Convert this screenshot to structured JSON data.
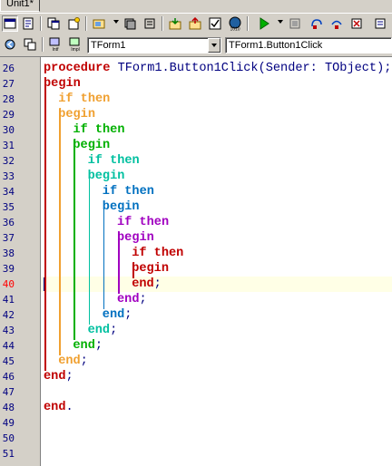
{
  "tab": {
    "label": "Unit1*"
  },
  "combos": {
    "class_name": "TForm1",
    "method_name": "TForm1.Button1Click"
  },
  "gutter": {
    "line_numbers": [
      "26",
      "27",
      "28",
      "29",
      "30",
      "31",
      "32",
      "33",
      "34",
      "35",
      "36",
      "37",
      "38",
      "39",
      "40",
      "41",
      "42",
      "43",
      "44",
      "45",
      "46",
      "47",
      "48",
      "49",
      "50",
      "51"
    ],
    "current_line": "40"
  },
  "code": {
    "lines": [
      {
        "indent": 0,
        "keyword": "procedure",
        "rest": " TForm1.Button1Click(Sender: TObject);",
        "color": "#c00000"
      },
      {
        "indent": 0,
        "keyword": "begin",
        "rest": "",
        "color": "#c00000"
      },
      {
        "indent": 1,
        "keyword": "if then",
        "rest": "",
        "color": "#f0a030"
      },
      {
        "indent": 1,
        "keyword": "begin",
        "rest": "",
        "color": "#f0a030"
      },
      {
        "indent": 2,
        "keyword": "if then",
        "rest": "",
        "color": "#00b000"
      },
      {
        "indent": 2,
        "keyword": "begin",
        "rest": "",
        "color": "#00b000"
      },
      {
        "indent": 3,
        "keyword": "if then",
        "rest": "",
        "color": "#00c0a0"
      },
      {
        "indent": 3,
        "keyword": "begin",
        "rest": "",
        "color": "#00c0a0"
      },
      {
        "indent": 4,
        "keyword": "if then",
        "rest": "",
        "color": "#0070c0"
      },
      {
        "indent": 4,
        "keyword": "begin",
        "rest": "",
        "color": "#0070c0"
      },
      {
        "indent": 5,
        "keyword": "if then",
        "rest": "",
        "color": "#a000c0"
      },
      {
        "indent": 5,
        "keyword": "begin",
        "rest": "",
        "color": "#a000c0"
      },
      {
        "indent": 6,
        "keyword": "if then",
        "rest": "",
        "color": "#c00000"
      },
      {
        "indent": 6,
        "keyword": "begin",
        "rest": "",
        "color": "#c00000"
      },
      {
        "indent": 6,
        "keyword": "end",
        "rest": ";",
        "color": "#c00000"
      },
      {
        "indent": 5,
        "keyword": "end",
        "rest": ";",
        "color": "#a000c0"
      },
      {
        "indent": 4,
        "keyword": "end",
        "rest": ";",
        "color": "#0070c0"
      },
      {
        "indent": 3,
        "keyword": "end",
        "rest": ";",
        "color": "#00c0a0"
      },
      {
        "indent": 2,
        "keyword": "end",
        "rest": ";",
        "color": "#00b000"
      },
      {
        "indent": 1,
        "keyword": "end",
        "rest": ";",
        "color": "#f0a030"
      },
      {
        "indent": 0,
        "keyword": "end",
        "rest": ";",
        "color": "#c00000"
      },
      {
        "indent": 0,
        "keyword": "",
        "rest": "",
        "color": "#000080"
      },
      {
        "indent": 0,
        "keyword": "end",
        "rest": ".",
        "color": "#c00000"
      },
      {
        "indent": 0,
        "keyword": "",
        "rest": "",
        "color": "#000080"
      },
      {
        "indent": 0,
        "keyword": "",
        "rest": "",
        "color": "#000080"
      },
      {
        "indent": 0,
        "keyword": "",
        "rest": "",
        "color": "#000080"
      }
    ]
  },
  "structure_guides": [
    {
      "from_line": "27",
      "to_line": "46",
      "color": "#c00000"
    },
    {
      "from_line": "29",
      "to_line": "45",
      "color": "#f0a030"
    },
    {
      "from_line": "31",
      "to_line": "44",
      "color": "#00b000"
    },
    {
      "from_line": "33",
      "to_line": "43",
      "color": "#00c0a0"
    },
    {
      "from_line": "35",
      "to_line": "42",
      "color": "#0070c0"
    },
    {
      "from_line": "37",
      "to_line": "41",
      "color": "#a000c0"
    },
    {
      "from_line": "39",
      "to_line": "40",
      "color": "#c00000"
    }
  ],
  "toolbar_icons": {
    "row1": [
      "view-unit-icon",
      "view-form-icon",
      "toggle-form-unit-icon",
      "new-form-icon",
      "open-project-icon",
      "save-all-icon",
      "remove-file-icon",
      "add-file-icon",
      "open-file-icon",
      "save-icon",
      "compile-icon",
      "run-icon",
      "pause-icon",
      "trace-into-icon",
      "step-over-icon",
      "run-to-cursor-icon"
    ],
    "row2": [
      "back-icon",
      "forward-icon",
      "interface-icon",
      "implementation-icon"
    ]
  }
}
